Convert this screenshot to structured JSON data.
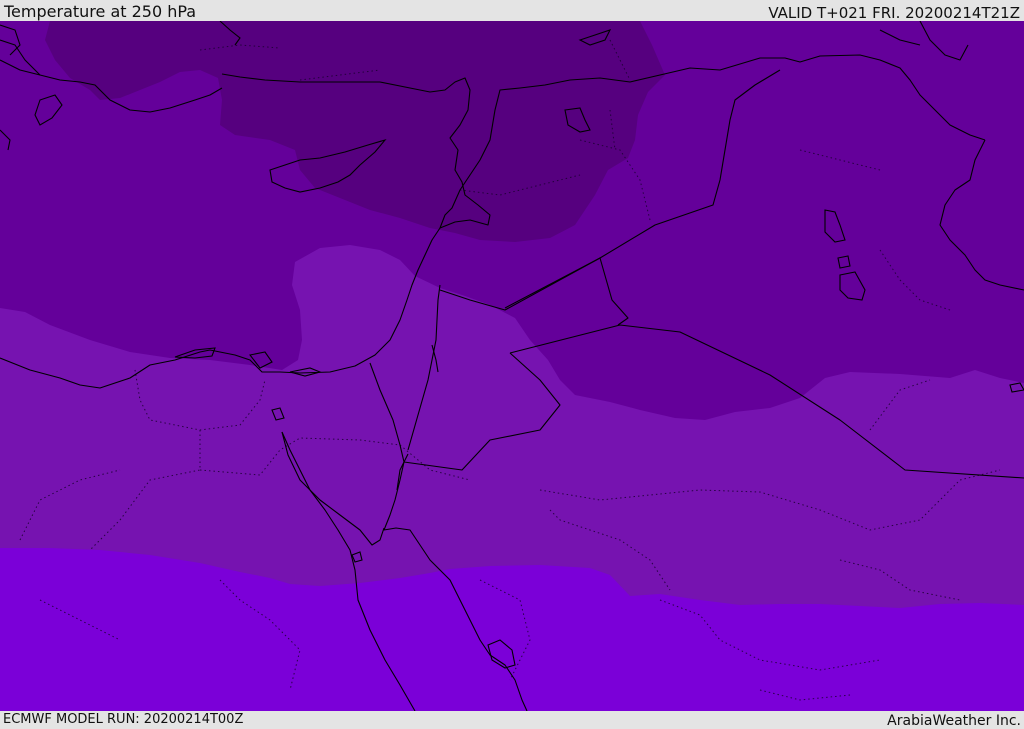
{
  "header": {
    "title": "Temperature at 250 hPa",
    "valid_time": "VALID T+021 FRI. 20200214T21Z"
  },
  "footer": {
    "model_run": "ECMWF MODEL RUN: 20200214T00Z",
    "credit": "ArabiaWeather Inc."
  },
  "colors": {
    "coldest_band": "#56007f",
    "cold_band": "#64009a",
    "mid_band": "#7613b0",
    "warm_band": "#7b00d8",
    "coastline": "#000000",
    "bar_background": "#e4e4e4"
  }
}
